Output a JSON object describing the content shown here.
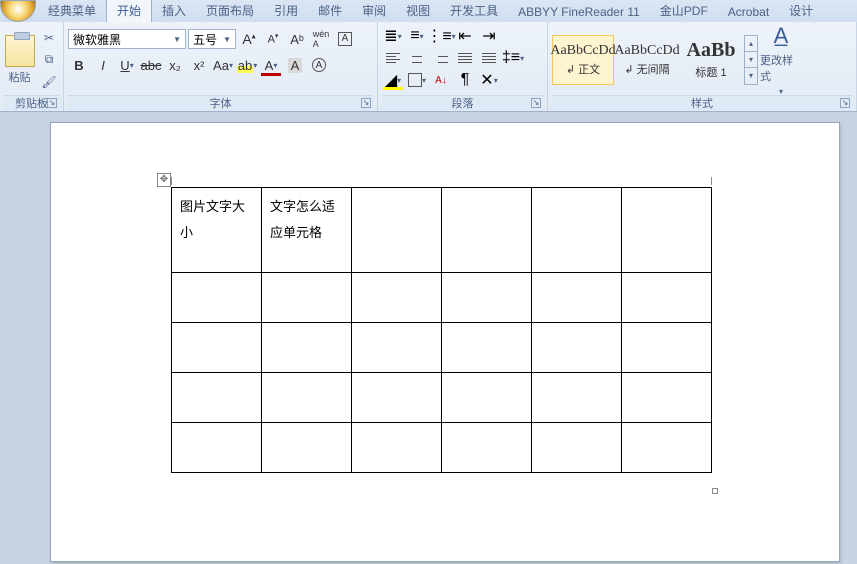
{
  "tabs": {
    "classic": "经典菜单",
    "home": "开始",
    "insert": "插入",
    "layout": "页面布局",
    "references": "引用",
    "mail": "邮件",
    "review": "审阅",
    "view": "视图",
    "dev": "开发工具",
    "abbyy": "ABBYY FineReader 11",
    "jspdf": "金山PDF",
    "acrobat": "Acrobat",
    "design": "设计"
  },
  "clipboard": {
    "paste": "粘贴",
    "group": "剪贴板"
  },
  "font": {
    "name": "微软雅黑",
    "size": "五号",
    "group": "字体"
  },
  "paragraph": {
    "group": "段落"
  },
  "styles": {
    "group": "样式",
    "normal": {
      "preview": "AaBbCcDd",
      "label": "↲ 正文"
    },
    "nospacing": {
      "preview": "AaBbCcDd",
      "label": "↲ 无间隔"
    },
    "heading1": {
      "preview": "AaBb",
      "label": "标题 1"
    },
    "change": "更改样式"
  },
  "document": {
    "cell_a1": "图片文字大小",
    "cell_b1": "文字怎么适应单元格"
  }
}
